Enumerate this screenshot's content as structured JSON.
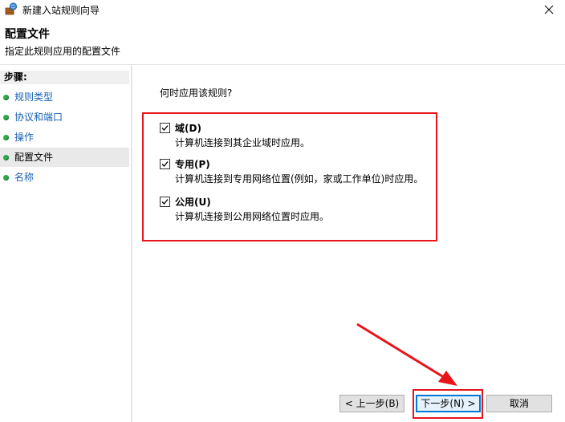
{
  "window": {
    "title": "新建入站规则向导",
    "icon": "firewall-wizard-icon"
  },
  "header": {
    "title": "配置文件",
    "description": "指定此规则应用的配置文件"
  },
  "sidebar": {
    "heading": "步骤:",
    "items": [
      {
        "label": "规则类型",
        "active": false
      },
      {
        "label": "协议和端口",
        "active": false
      },
      {
        "label": "操作",
        "active": false
      },
      {
        "label": "配置文件",
        "active": true
      },
      {
        "label": "名称",
        "active": false
      }
    ]
  },
  "main": {
    "question": "何时应用该规则?",
    "options": [
      {
        "label": "域(D)",
        "description": "计算机连接到其企业域时应用。",
        "checked": true
      },
      {
        "label": "专用(P)",
        "description": "计算机连接到专用网络位置(例如，家或工作单位)时应用。",
        "checked": true
      },
      {
        "label": "公用(U)",
        "description": "计算机连接到公用网络位置时应用。",
        "checked": true
      }
    ]
  },
  "buttons": {
    "back": "< 上一步(B)",
    "next": "下一步(N) >",
    "cancel": "取消"
  },
  "colors": {
    "highlight": "#e8141a",
    "step_bullet": "#2fa84f",
    "link": "#1560b3",
    "primary_border": "#0078d7"
  }
}
